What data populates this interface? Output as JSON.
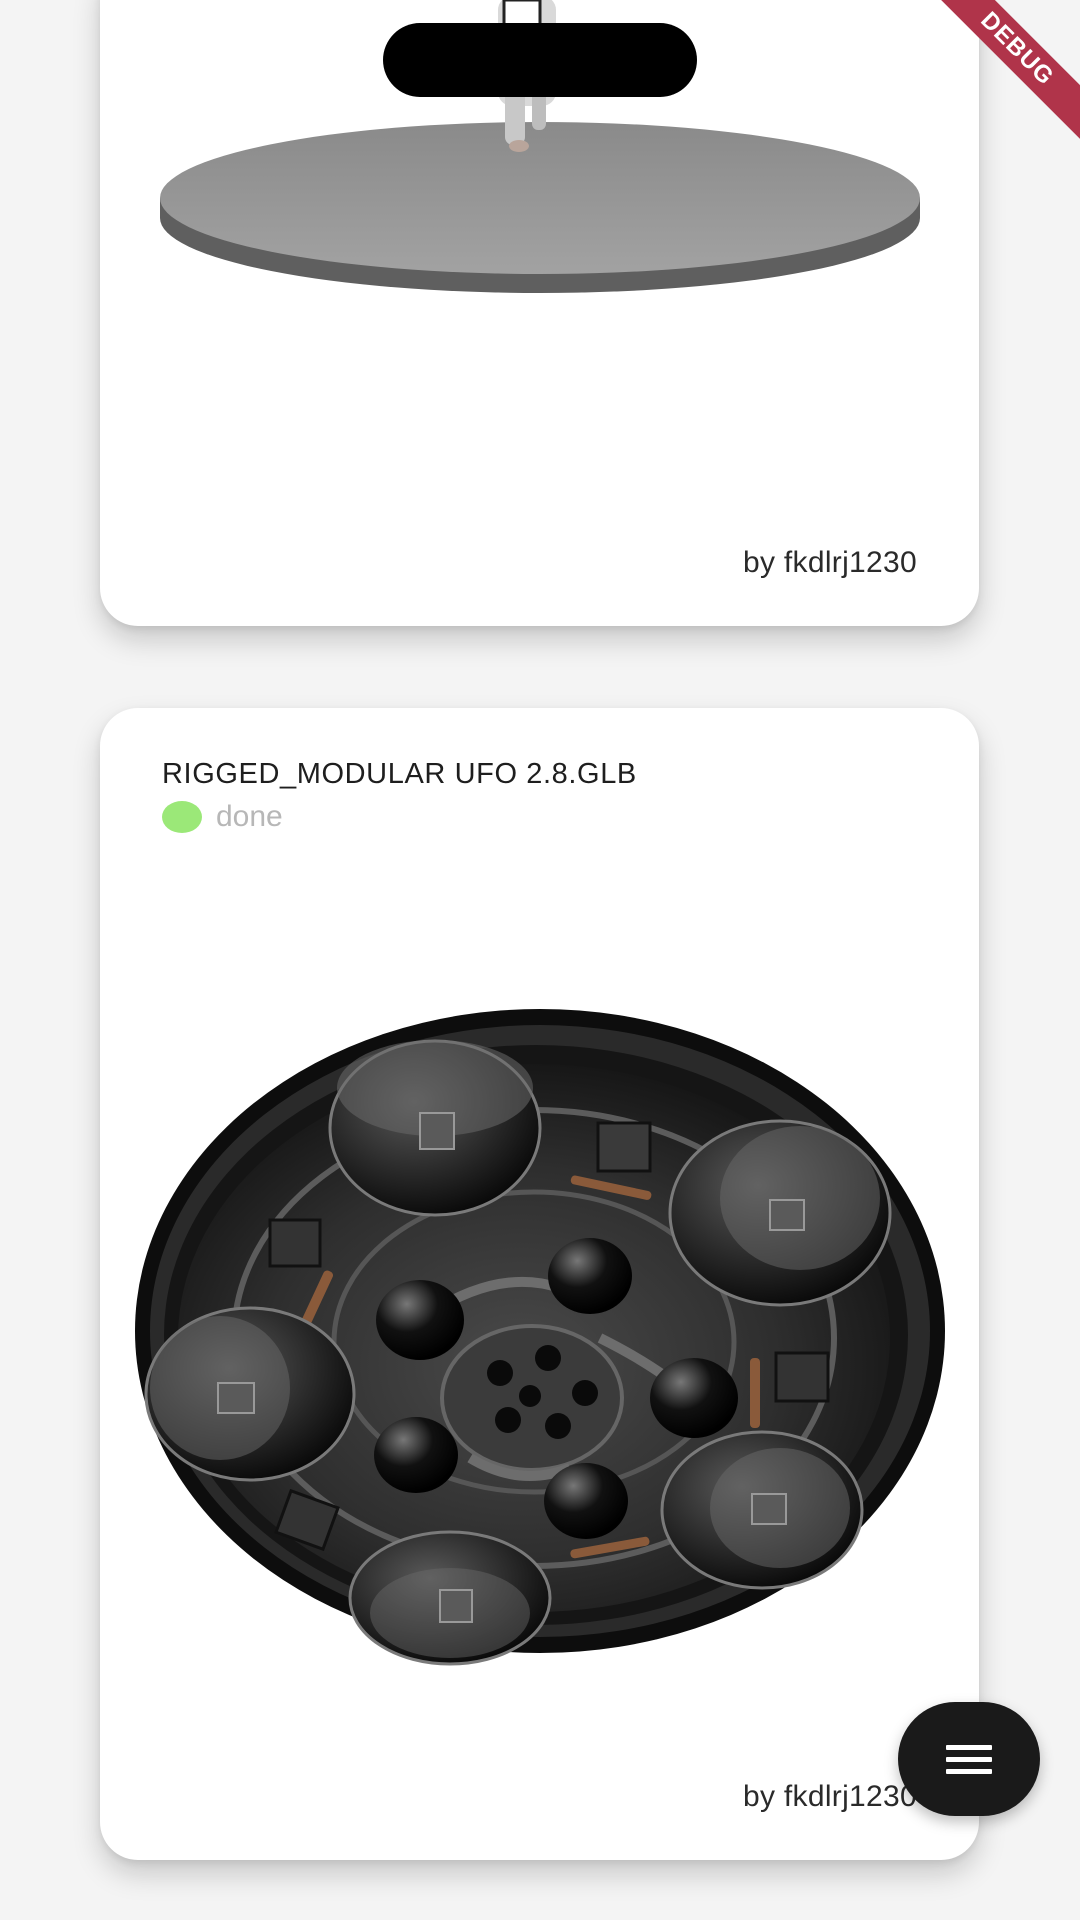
{
  "system": {
    "debug_banner": "DEBUG"
  },
  "cards": [
    {
      "author": "by fkdlrj1230",
      "preview_icon": "figure-on-platform-3d-model"
    },
    {
      "title": "RIGGED_MODULAR UFO 2.8.GLB",
      "status": "done",
      "status_color": "#9be878",
      "author": "by fkdlrj1230",
      "preview_icon": "ufo-3d-model"
    }
  ],
  "fab": {
    "icon": "menu-icon"
  }
}
